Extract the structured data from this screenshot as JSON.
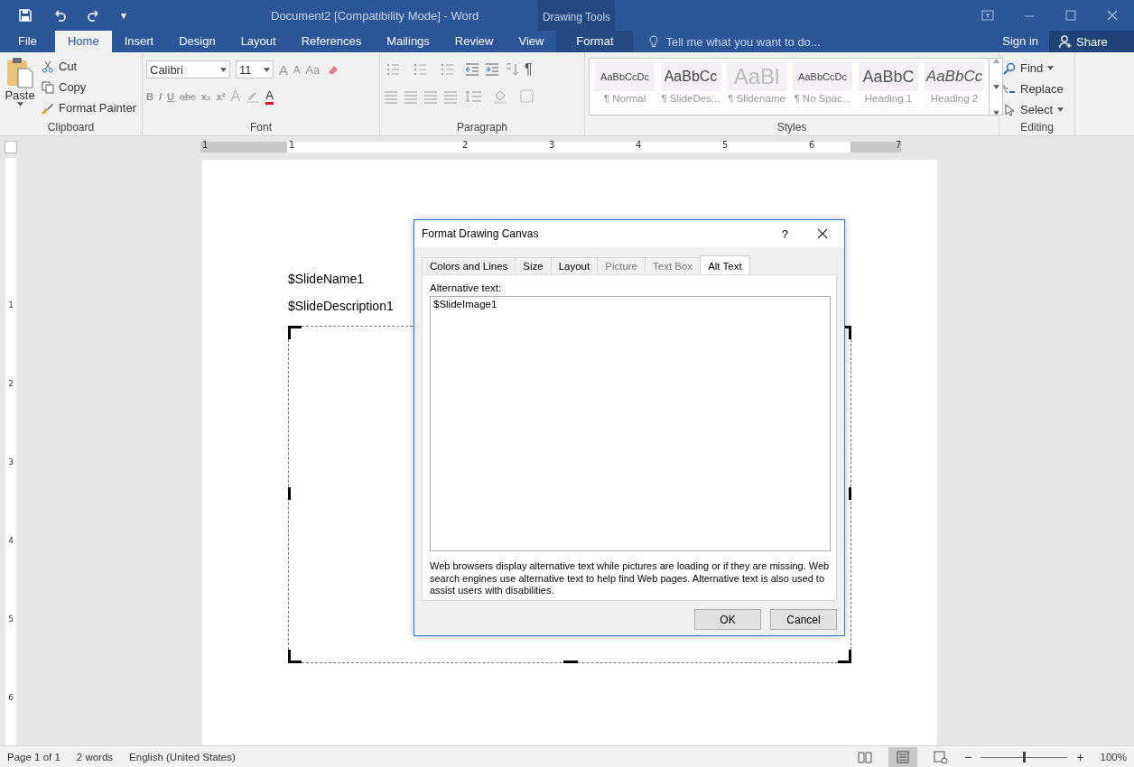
{
  "window": {
    "title": "Document2 [Compatibility Mode] - Word",
    "context_title": "Drawing Tools",
    "qat_more": "▾"
  },
  "ribbon_tabs": [
    {
      "label": "File",
      "selected": false,
      "kind": "file"
    },
    {
      "label": "Home",
      "selected": true,
      "kind": "tab"
    },
    {
      "label": "Insert",
      "selected": false,
      "kind": "tab"
    },
    {
      "label": "Design",
      "selected": false,
      "kind": "tab"
    },
    {
      "label": "Layout",
      "selected": false,
      "kind": "tab"
    },
    {
      "label": "References",
      "selected": false,
      "kind": "tab"
    },
    {
      "label": "Mailings",
      "selected": false,
      "kind": "tab"
    },
    {
      "label": "Review",
      "selected": false,
      "kind": "tab"
    },
    {
      "label": "View",
      "selected": false,
      "kind": "tab"
    },
    {
      "label": "Format",
      "selected": false,
      "kind": "context"
    }
  ],
  "tell_me": {
    "placeholder": "Tell me what you want to do..."
  },
  "sign_in": "Sign in",
  "share": "Share",
  "clipboard": {
    "label": "Clipboard",
    "paste": "Paste",
    "items": [
      "Cut",
      "Copy",
      "Format Painter"
    ]
  },
  "font": {
    "label": "Font",
    "name": "Calibri",
    "size": "11",
    "grow": "A",
    "shrink": "A",
    "case": "Aa",
    "formats": [
      "B",
      "I",
      "U",
      "abc",
      "x₂",
      "x²"
    ],
    "effects": "A",
    "color_letter": "A"
  },
  "paragraph": {
    "label": "Paragraph",
    "marks": "¶"
  },
  "styles": {
    "label": "Styles",
    "items": [
      {
        "preview": "AaBbCcDc",
        "name": "¶ Normal",
        "kind": "small"
      },
      {
        "preview": "AaBbCc",
        "name": "¶ SlideDes...",
        "kind": "medium"
      },
      {
        "preview": "AaBl",
        "name": "¶ Slidename",
        "kind": "large"
      },
      {
        "preview": "AaBbCcDc",
        "name": "¶ No Spac...",
        "kind": "small"
      },
      {
        "preview": "AaBbC",
        "name": "Heading 1",
        "kind": "heading"
      },
      {
        "preview": "AaBbCc",
        "name": "Heading 2",
        "kind": "italic"
      }
    ]
  },
  "editing": {
    "label": "Editing",
    "items": [
      {
        "label": "Find",
        "kind": "find"
      },
      {
        "label": "Replace",
        "kind": "replace"
      },
      {
        "label": "Select",
        "kind": "select"
      }
    ]
  },
  "ruler": {
    "numbers": [
      "1",
      "1",
      "2",
      "3",
      "4",
      "5",
      "6",
      "7"
    ],
    "vertical_numbers": [
      "1",
      "2",
      "3",
      "4",
      "5",
      "6"
    ]
  },
  "document": {
    "paragraphs": [
      "$SlideName1",
      "$SlideDescription1"
    ]
  },
  "dialog": {
    "title": "Format Drawing Canvas",
    "help": "?",
    "tabs": [
      {
        "label": "Colors and Lines",
        "selected": false,
        "disabled": false
      },
      {
        "label": "Size",
        "selected": false,
        "disabled": false
      },
      {
        "label": "Layout",
        "selected": false,
        "disabled": false
      },
      {
        "label": "Picture",
        "selected": false,
        "disabled": true
      },
      {
        "label": "Text Box",
        "selected": false,
        "disabled": true
      },
      {
        "label": "Alt Text",
        "selected": true,
        "disabled": false
      }
    ],
    "field_label": "Alternative text:",
    "value": "$SlideImage1",
    "note": "Web browsers display alternative text while pictures are loading or if they are missing. Web search engines use alternative text to help find Web pages.  Alternative text is also used to assist users with disabilities.",
    "buttons": [
      "OK",
      "Cancel"
    ]
  },
  "status_bar": {
    "page": "Page 1 of 1",
    "words": "2 words",
    "language": "English (United States)",
    "zoom": {
      "level": 0.5
    },
    "zoom_text": "100%",
    "zoom_out": "−",
    "zoom_in": "+"
  }
}
